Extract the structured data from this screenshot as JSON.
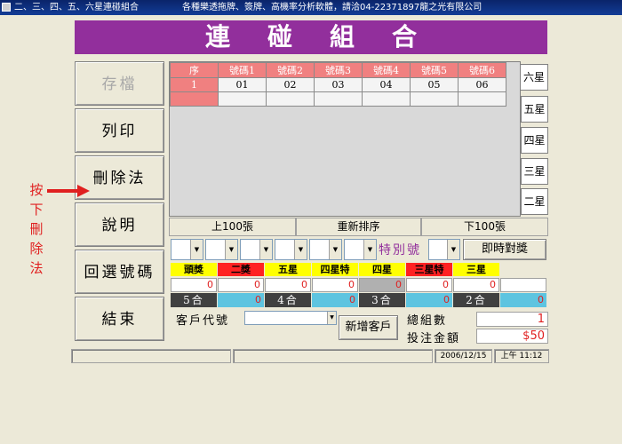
{
  "titlebar": {
    "app_title": "二、三、四、五、六星連碰組合",
    "vendor": "各種樂透拖牌、簽牌、高機率分析軟體，請洽04-22371897龍之光有限公司"
  },
  "banner": "連碰組合",
  "left_buttons": [
    {
      "label": "存檔",
      "disabled": true
    },
    {
      "label": "列印",
      "disabled": false
    },
    {
      "label": "刪除法",
      "disabled": false
    },
    {
      "label": "說明",
      "disabled": false
    },
    {
      "label": "回選號碼",
      "disabled": false
    },
    {
      "label": "結束",
      "disabled": false
    }
  ],
  "side_note": [
    "按",
    "下",
    "刪",
    "除",
    "法"
  ],
  "grid": {
    "headers": [
      "序",
      "號碼1",
      "號碼2",
      "號碼3",
      "號碼4",
      "號碼5",
      "號碼6"
    ],
    "rows": [
      [
        "1",
        "01",
        "02",
        "03",
        "04",
        "05",
        "06"
      ]
    ]
  },
  "star_tabs": [
    "六星",
    "五星",
    "四星",
    "三星",
    "二星"
  ],
  "nav": {
    "prev": "上100張",
    "resort": "重新排序",
    "next": "下100張"
  },
  "special_label": "特別號",
  "check_button": "即時對獎",
  "prizes": [
    {
      "label": "頭獎",
      "color": "yellow",
      "value": "0"
    },
    {
      "label": "二獎",
      "color": "red",
      "value": "0"
    },
    {
      "label": "五星",
      "color": "yellow",
      "value": "0"
    },
    {
      "label": "四星特",
      "color": "yellow",
      "value": "0"
    },
    {
      "label": "四星",
      "color": "yellow",
      "value": "0"
    },
    {
      "label": "三星特",
      "color": "red",
      "value": "0"
    },
    {
      "label": "三星",
      "color": "yellow",
      "value": "0"
    }
  ],
  "combos": [
    {
      "label": "5合",
      "value": "0"
    },
    {
      "label": "4合",
      "value": "0"
    },
    {
      "label": "3合",
      "value": "0"
    },
    {
      "label": "2合",
      "value": "0"
    }
  ],
  "customer": {
    "label": "客戶代號",
    "value": "",
    "add_button": "新增客戶"
  },
  "summary": {
    "total_label": "總組數",
    "total_value": "1",
    "amount_label": "投注金額",
    "amount_value": "$50"
  },
  "status": {
    "date": "2006/12/15",
    "time": "上午 11:12"
  },
  "colors": {
    "banner": "#922f9c",
    "header_red": "#f08080",
    "cyan": "#5ec4e0"
  }
}
